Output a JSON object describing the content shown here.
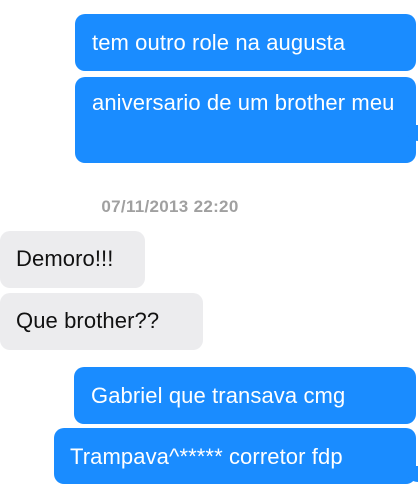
{
  "messages": [
    {
      "direction": "outgoing",
      "text": "tem outro role na augusta"
    },
    {
      "direction": "outgoing",
      "text": "aniversario de um brother meu"
    },
    {
      "direction": "incoming",
      "text": "Demoro!!!"
    },
    {
      "direction": "incoming",
      "text": "Que brother??"
    },
    {
      "direction": "outgoing",
      "text": "Gabriel que transava cmg"
    },
    {
      "direction": "outgoing",
      "text": "Trampava^***** corretor fdp"
    }
  ],
  "timestamp": "07/11/2013 22:20",
  "colors": {
    "outgoing_bubble": "#1a8cff",
    "incoming_bubble": "#ececee",
    "timestamp_text": "#a0a0a0"
  }
}
